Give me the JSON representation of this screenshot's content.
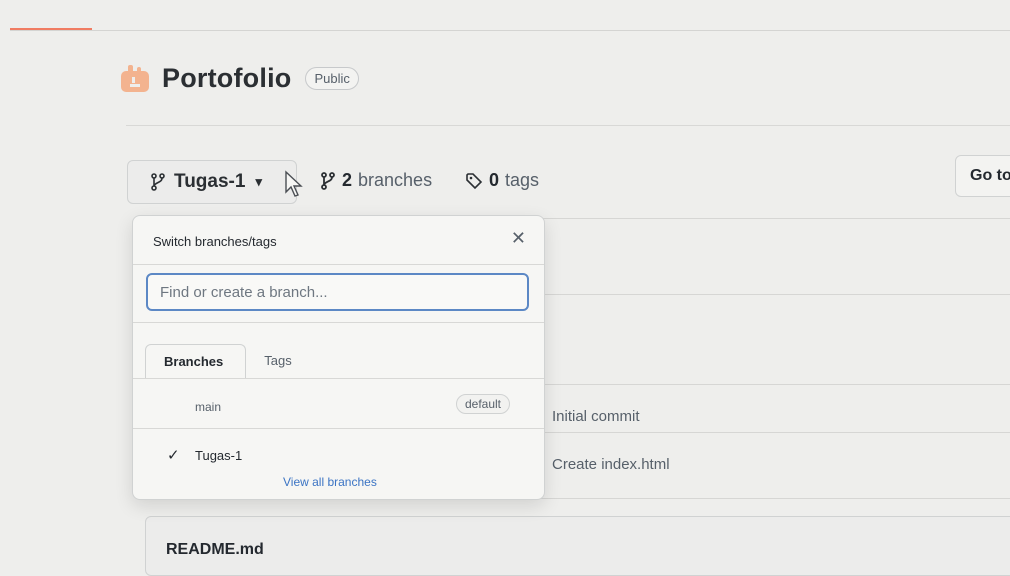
{
  "repo": {
    "icon": "repo-owner-avatar-icon",
    "name": "Portofolio",
    "visibility": "Public"
  },
  "toolbar": {
    "current_branch": "Tugas-1",
    "branches_count": "2",
    "branches_label": "branches",
    "tags_count": "0",
    "tags_label": "tags",
    "goto_label": "Go to"
  },
  "dropdown": {
    "title": "Switch branches/tags",
    "filter_placeholder": "Find or create a branch...",
    "tabs": [
      "Branches",
      "Tags"
    ],
    "branches": [
      {
        "name": "main",
        "badge": "default",
        "selected": false
      },
      {
        "name": "Tugas-1",
        "badge": "",
        "selected": true
      }
    ],
    "view_all": "View all branches"
  },
  "files": {
    "commits": [
      "Initial commit",
      "Create index.html"
    ]
  },
  "readme": {
    "label": "README.md"
  },
  "colors": {
    "accent": "#f07c62",
    "focus_border": "#5c88c5",
    "link": "#3b74c4"
  }
}
